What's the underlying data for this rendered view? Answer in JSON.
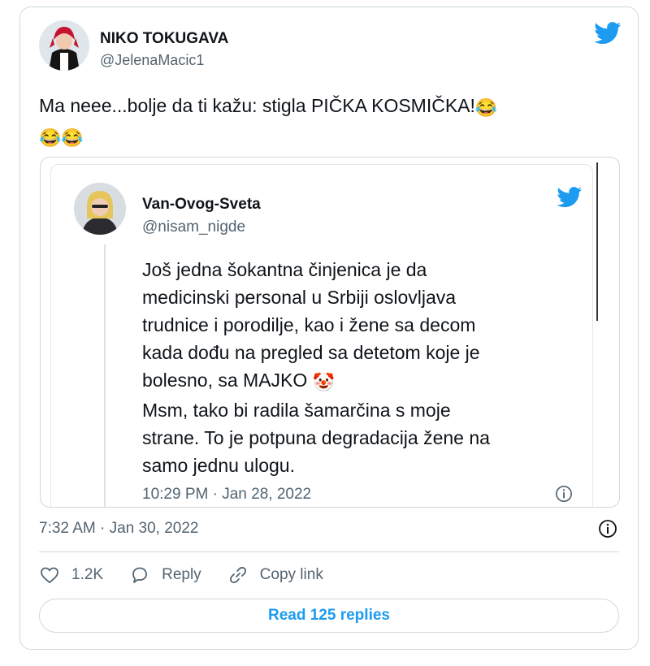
{
  "tweet": {
    "author_name": "NIKO TOKUGAVA",
    "author_handle": "@JelenaMacic1",
    "text": "Ma neee...bolje da ti kažu: stigla PIČKA KOSMIČKA!",
    "emoji": "😂",
    "timestamp": "7:32 AM · Jan 30, 2022"
  },
  "quoted": {
    "author_name": "Van-Ovog-Sveta",
    "author_handle": "@nisam_nigde",
    "lines": [
      "Još jedna šokantna činjenica je da",
      "medicinski personal u Srbiji oslovljava",
      "trudnice i porodilje, kao i žene sa decom",
      "kada dođu na pregled sa detetom koje je",
      "bolesno, sa MAJKO",
      "Msm, tako bi radila šamarčina s moje",
      "strane. To je potpuna degradacija žene na",
      "samo jednu ulogu."
    ],
    "clown_emoji": "🤡",
    "timestamp": "10:29 PM · Jan 28, 2022"
  },
  "actions": {
    "like_count": "1.2K",
    "reply_label": "Reply",
    "copy_label": "Copy link"
  },
  "read_replies_label": "Read 125 replies",
  "colors": {
    "accent": "#1d9bf0",
    "muted": "#536471",
    "border": "#cfd9de"
  },
  "icons": [
    "twitter-bird-icon",
    "heart-icon",
    "reply-icon",
    "link-icon",
    "info-icon"
  ]
}
